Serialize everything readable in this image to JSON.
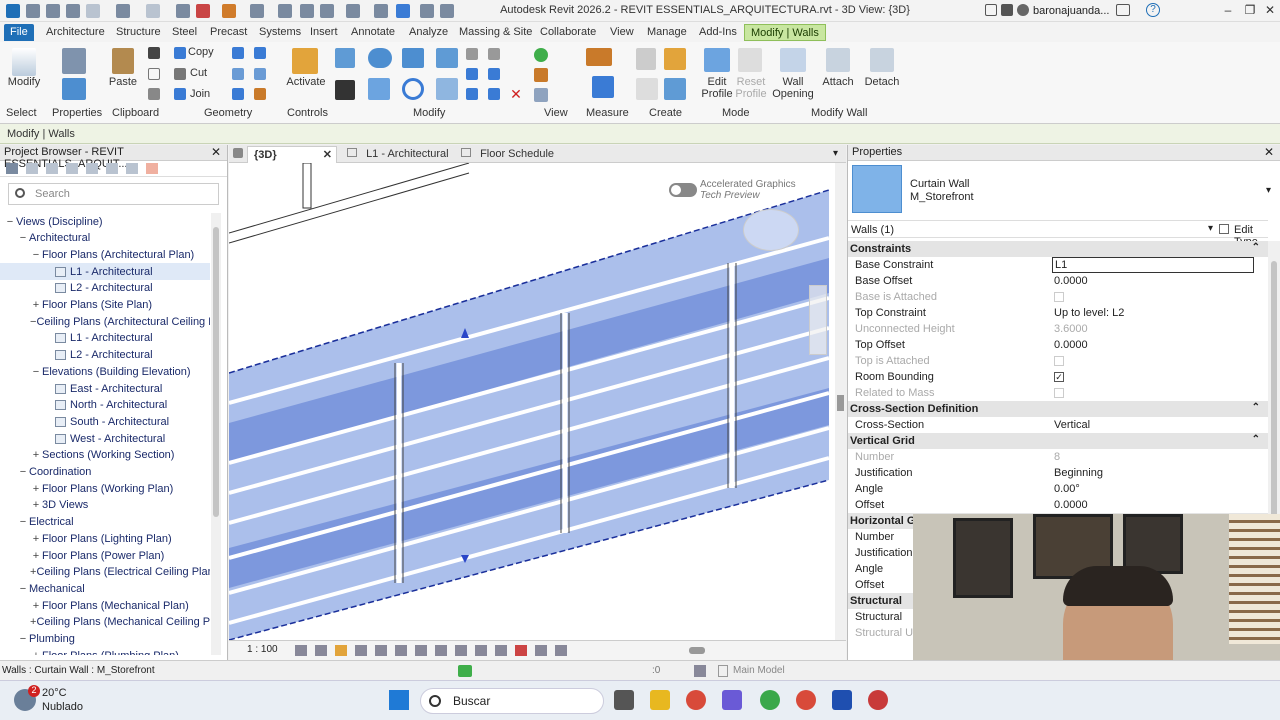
{
  "window": {
    "title": "Autodesk Revit 2026.2 - REVIT ESSENTIALS_ARQUITECTURA.rvt - 3D View: {3D}",
    "user": "baronajuanda...",
    "help": "?"
  },
  "tabs": [
    "File",
    "Architecture",
    "Structure",
    "Steel",
    "Precast",
    "Systems",
    "Insert",
    "Annotate",
    "Analyze",
    "Massing & Site",
    "Collaborate",
    "View",
    "Manage",
    "Add-Ins",
    "Modify | Walls"
  ],
  "ribbon": {
    "buttons": {
      "modify": "Modify",
      "paste": "Paste",
      "copy": "Copy",
      "cut": "Cut",
      "join": "Join",
      "activate": "Activate",
      "edit_profile": "Edit\nProfile",
      "reset_profile": "Reset\nProfile",
      "wall_opening": "Wall\nOpening",
      "attach": "Attach",
      "detach": "Detach"
    },
    "panels": [
      "Select",
      "Properties",
      "Clipboard",
      "Geometry",
      "Controls",
      "Modify",
      "View",
      "Measure",
      "Create",
      "Mode",
      "Modify Wall"
    ]
  },
  "context_label": "Modify | Walls",
  "project_browser": {
    "header": "Project Browser - REVIT ESSENTIALS_ARQUIT...",
    "search_placeholder": "Search",
    "rows": [
      {
        "t": "−",
        "label": "Views (Discipline)",
        "lvl": 0
      },
      {
        "t": "−",
        "label": "Architectural",
        "lvl": 1
      },
      {
        "t": "−",
        "label": "Floor Plans (Architectural Plan)",
        "lvl": 2
      },
      {
        "t": "",
        "label": "L1 - Architectural",
        "lvl": 3,
        "sel": true
      },
      {
        "t": "",
        "label": "L2 - Architectural",
        "lvl": 3
      },
      {
        "t": "+",
        "label": "Floor Plans (Site Plan)",
        "lvl": 2
      },
      {
        "t": "−",
        "label": "Ceiling Plans (Architectural Ceiling Pl",
        "lvl": 2
      },
      {
        "t": "",
        "label": "L1 - Architectural",
        "lvl": 3
      },
      {
        "t": "",
        "label": "L2 - Architectural",
        "lvl": 3
      },
      {
        "t": "−",
        "label": "Elevations (Building Elevation)",
        "lvl": 2
      },
      {
        "t": "",
        "label": "East - Architectural",
        "lvl": 3
      },
      {
        "t": "",
        "label": "North - Architectural",
        "lvl": 3
      },
      {
        "t": "",
        "label": "South - Architectural",
        "lvl": 3
      },
      {
        "t": "",
        "label": "West - Architectural",
        "lvl": 3
      },
      {
        "t": "+",
        "label": "Sections (Working Section)",
        "lvl": 2
      },
      {
        "t": "−",
        "label": "Coordination",
        "lvl": 1
      },
      {
        "t": "+",
        "label": "Floor Plans (Working Plan)",
        "lvl": 2
      },
      {
        "t": "+",
        "label": "3D Views",
        "lvl": 2
      },
      {
        "t": "−",
        "label": "Electrical",
        "lvl": 1
      },
      {
        "t": "+",
        "label": "Floor Plans (Lighting Plan)",
        "lvl": 2
      },
      {
        "t": "+",
        "label": "Floor Plans (Power Plan)",
        "lvl": 2
      },
      {
        "t": "+",
        "label": "Ceiling Plans (Electrical Ceiling Plan)",
        "lvl": 2
      },
      {
        "t": "−",
        "label": "Mechanical",
        "lvl": 1
      },
      {
        "t": "+",
        "label": "Floor Plans (Mechanical Plan)",
        "lvl": 2
      },
      {
        "t": "+",
        "label": "Ceiling Plans (Mechanical Ceiling Plar",
        "lvl": 2
      },
      {
        "t": "−",
        "label": "Plumbing",
        "lvl": 1
      },
      {
        "t": "+",
        "label": "Floor Plans (Plumbing Plan)",
        "lvl": 2
      }
    ]
  },
  "view_tabs": [
    {
      "label": "{3D}",
      "active": true
    },
    {
      "label": "L1 - Architectural"
    },
    {
      "label": "Floor Schedule"
    }
  ],
  "view": {
    "toggle_label": "Accelerated Graphics",
    "toggle_sub": "Tech Preview",
    "scale": "1 : 100",
    "model": "Main Model"
  },
  "properties": {
    "header": "Properties",
    "type_name": "Curtain Wall",
    "type_sub": "M_Storefront",
    "selector": "Walls (1)",
    "edit_type": "Edit Type",
    "groups": [
      {
        "title": "Constraints",
        "rows": [
          {
            "k": "Base Constraint",
            "v": "L1",
            "edit": true
          },
          {
            "k": "Base Offset",
            "v": "0.0000"
          },
          {
            "k": "Base is Attached",
            "v": "",
            "dis": true,
            "cb": false
          },
          {
            "k": "Top Constraint",
            "v": "Up to level: L2"
          },
          {
            "k": "Unconnected Height",
            "v": "3.6000",
            "dis": true
          },
          {
            "k": "Top Offset",
            "v": "0.0000"
          },
          {
            "k": "Top is Attached",
            "v": "",
            "dis": true,
            "cb": false
          },
          {
            "k": "Room Bounding",
            "v": "",
            "cb": true
          },
          {
            "k": "Related to Mass",
            "v": "",
            "dis": true,
            "cb": false
          }
        ]
      },
      {
        "title": "Cross-Section Definition",
        "rows": [
          {
            "k": "Cross-Section",
            "v": "Vertical"
          }
        ]
      },
      {
        "title": "Vertical Grid",
        "rows": [
          {
            "k": "Number",
            "v": "8",
            "dis": true
          },
          {
            "k": "Justification",
            "v": "Beginning"
          },
          {
            "k": "Angle",
            "v": "0.00°"
          },
          {
            "k": "Offset",
            "v": "0.0000"
          }
        ]
      },
      {
        "title": "Horizontal Grid",
        "rows": [
          {
            "k": "Number",
            "v": ""
          },
          {
            "k": "Justification",
            "v": ""
          },
          {
            "k": "Angle",
            "v": ""
          },
          {
            "k": "Offset",
            "v": ""
          }
        ]
      },
      {
        "title": "Structural",
        "rows": [
          {
            "k": "Structural",
            "v": ""
          },
          {
            "k": "Structural Usage",
            "v": "",
            "dis": true
          }
        ]
      }
    ]
  },
  "status": {
    "text": "Walls : Curtain Wall : M_Storefront",
    "zero": ":0"
  },
  "taskbar": {
    "temp": "20°C",
    "weather": "Nublado",
    "search": "Buscar",
    "badge": "2"
  }
}
